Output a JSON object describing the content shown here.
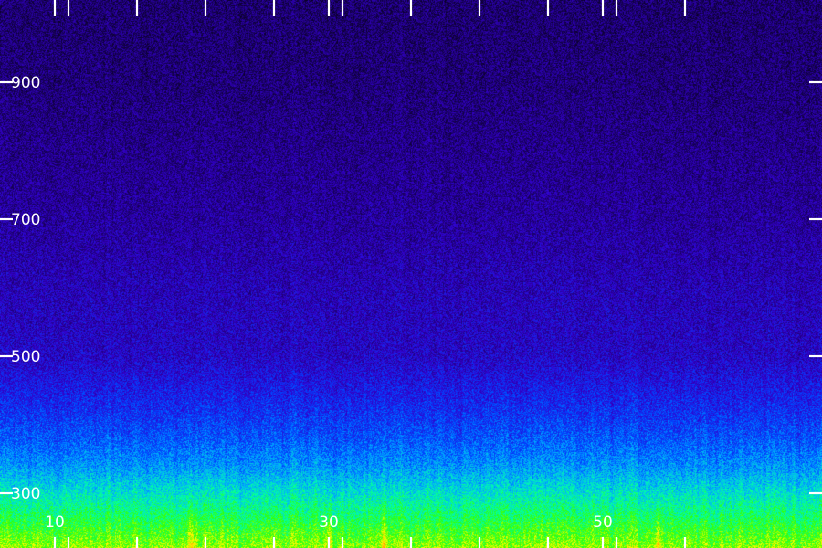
{
  "chart_data": {
    "type": "heatmap",
    "title": "",
    "xlabel": "",
    "ylabel": "",
    "xlim": [
      6,
      66
    ],
    "ylim": [
      220,
      1020
    ],
    "x_ticks": [
      10,
      30,
      50
    ],
    "y_ticks": [
      300,
      500,
      700,
      900
    ],
    "x_tick_labels": [
      "10",
      "30",
      "50"
    ],
    "y_tick_labels": [
      "300",
      "500",
      "700",
      "900"
    ],
    "x_minor_ticks": [
      6,
      11,
      16,
      21,
      26,
      31,
      36,
      41,
      46,
      51,
      56
    ],
    "colormap": [
      "#000000",
      "#1a0066",
      "#3300cc",
      "#0044ff",
      "#00aaff",
      "#00ffaa",
      "#33ff00",
      "#ffff00",
      "#ffaa00",
      "#ff0000"
    ],
    "intensity_profile": {
      "frequencies": [
        220,
        260,
        300,
        340,
        380,
        420,
        460,
        500,
        600,
        700,
        800,
        900,
        1020
      ],
      "levels": [
        0.72,
        0.62,
        0.52,
        0.42,
        0.35,
        0.3,
        0.26,
        0.22,
        0.2,
        0.17,
        0.15,
        0.13,
        0.12
      ]
    },
    "hot_bands_x": [
      20,
      30,
      34,
      54
    ]
  }
}
